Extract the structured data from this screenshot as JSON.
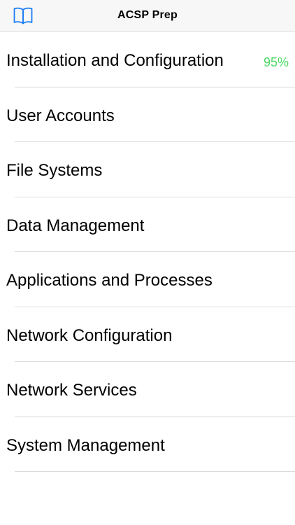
{
  "header": {
    "title": "ACSP Prep",
    "icon": "book-icon",
    "accent_color": "#1a7cf5"
  },
  "topics": [
    {
      "label": "Installation and Configuration",
      "badge": "95%"
    },
    {
      "label": "User Accounts",
      "badge": ""
    },
    {
      "label": "File Systems",
      "badge": ""
    },
    {
      "label": "Data Management",
      "badge": ""
    },
    {
      "label": "Applications and Processes",
      "badge": ""
    },
    {
      "label": "Network Configuration",
      "badge": ""
    },
    {
      "label": "Network Services",
      "badge": ""
    },
    {
      "label": "System Management",
      "badge": ""
    }
  ],
  "badge_color": "#4cd964"
}
